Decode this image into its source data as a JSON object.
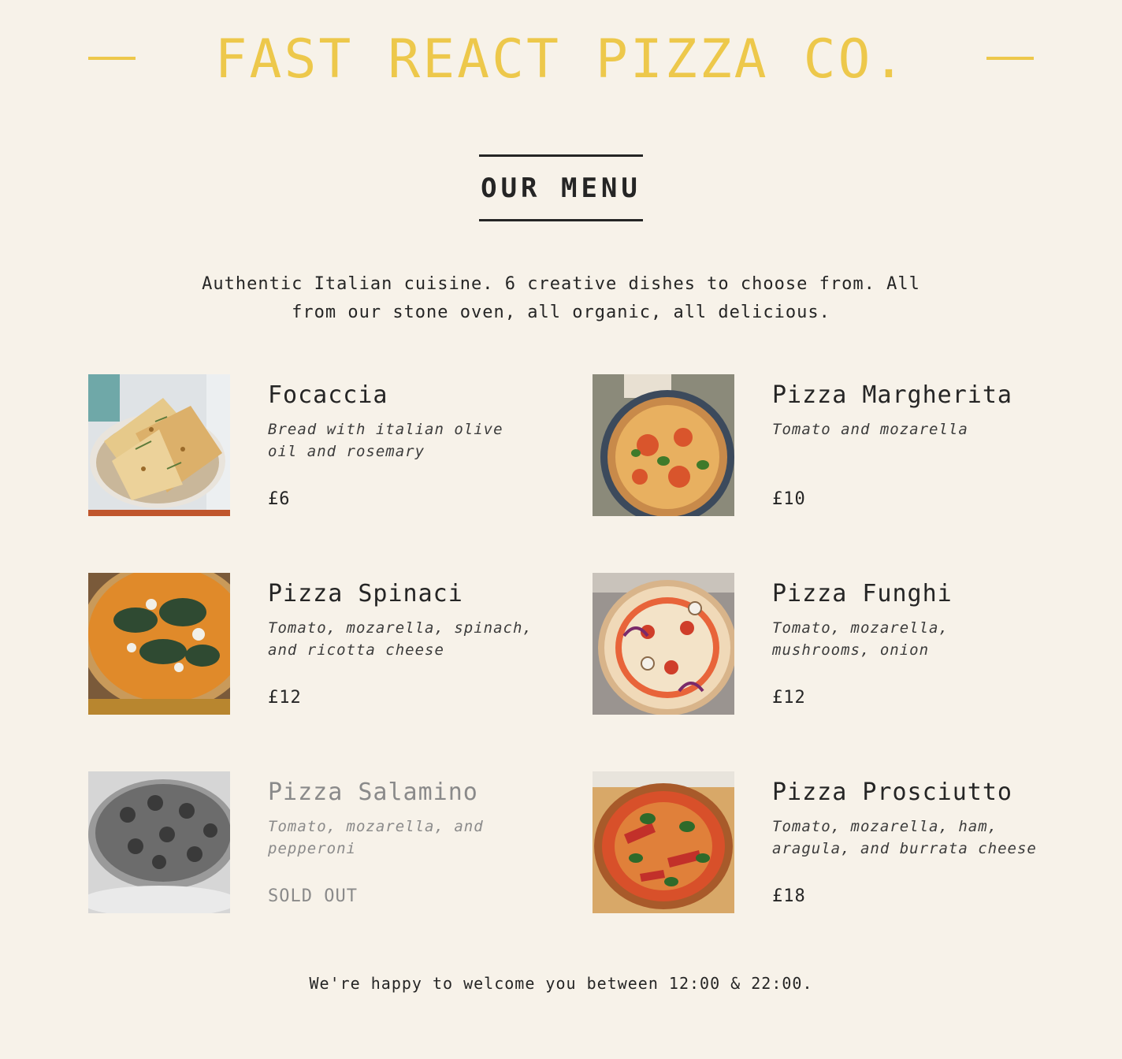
{
  "header": {
    "title": "FAST REACT PIZZA CO.",
    "accent_color": "#edc84b"
  },
  "menu": {
    "heading": "OUR MENU",
    "intro": "Authentic Italian cuisine. 6 creative dishes to choose from. All from our stone oven, all organic, all delicious."
  },
  "pizzas": [
    {
      "name": "Focaccia",
      "description": "Bread with italian olive oil and rosemary",
      "price": "£6",
      "image_icon": "focaccia-photo"
    },
    {
      "name": "Pizza Margherita",
      "description": "Tomato and mozarella",
      "price": "£10",
      "image_icon": "pizza-margherita-photo"
    },
    {
      "name": "Pizza Spinaci",
      "description": "Tomato, mozarella, spinach, and ricotta cheese",
      "price": "£12",
      "image_icon": "pizza-spinaci-photo"
    },
    {
      "name": "Pizza Funghi",
      "description": "Tomato, mozarella, mushrooms, onion",
      "price": "£12",
      "image_icon": "pizza-funghi-photo"
    },
    {
      "name": "Pizza Salamino",
      "description": "Tomato, mozarella, and pepperoni",
      "price": "SOLD OUT",
      "sold_out": true,
      "image_icon": "pizza-salamino-photo"
    },
    {
      "name": "Pizza Prosciutto",
      "description": "Tomato, mozarella, ham, aragula, and burrata cheese",
      "price": "£18",
      "image_icon": "pizza-prosciutto-photo"
    }
  ],
  "footer": {
    "text": "We're happy to welcome you between 12:00 & 22:00."
  }
}
